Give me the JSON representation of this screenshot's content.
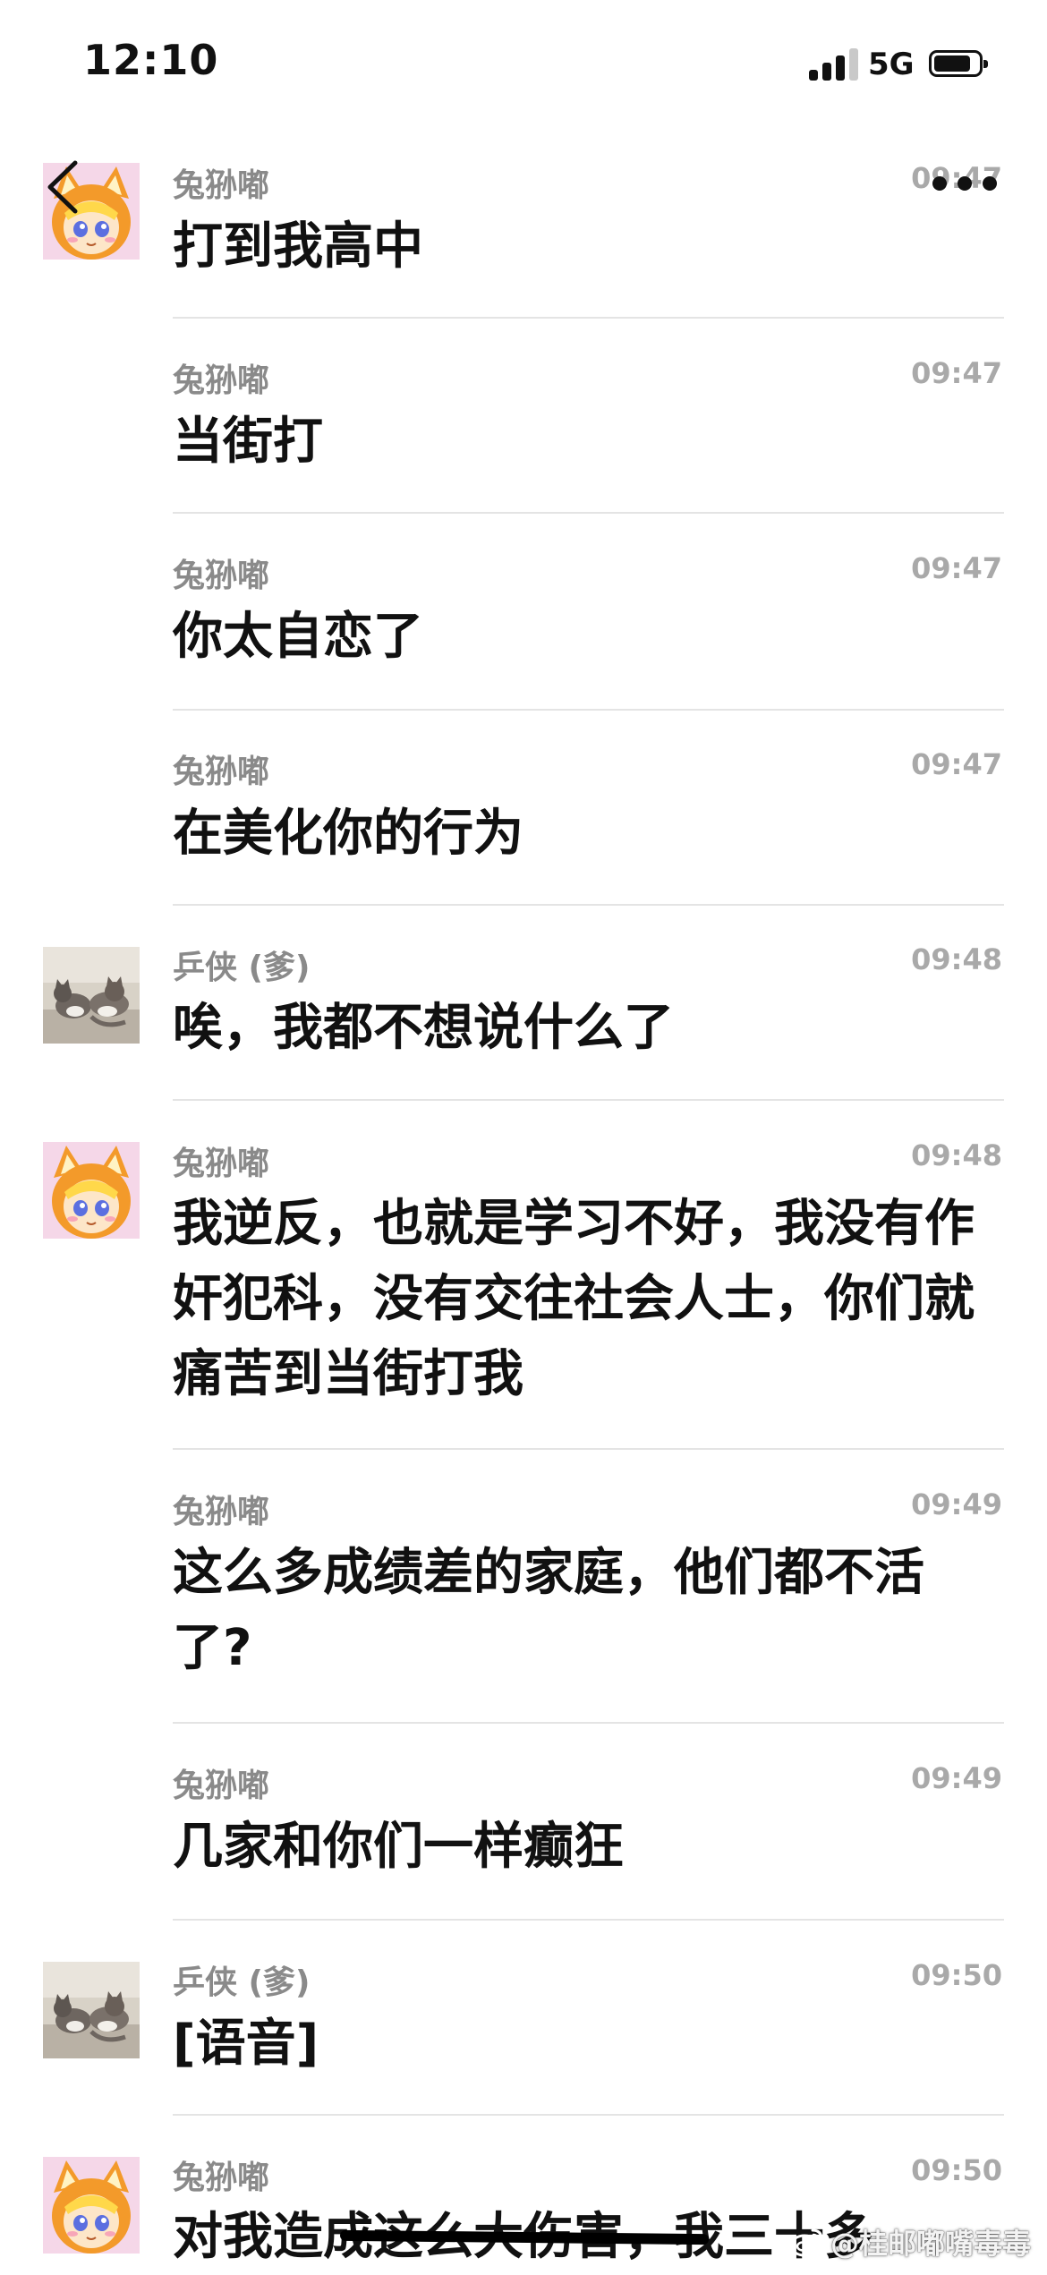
{
  "status_bar": {
    "time": "12:10",
    "network": "5G",
    "signal_bars_active": 3,
    "signal_bars_total": 4,
    "battery_level": 0.8
  },
  "nav": {
    "back_icon": "chevron-left-icon",
    "more_icon": "more-dots-icon"
  },
  "messages": [
    {
      "sender": "兔狲嘟",
      "time": "09:47",
      "text": "打到我高中",
      "avatar": "fox-avatar",
      "show_avatar": true
    },
    {
      "sender": "兔狲嘟",
      "time": "09:47",
      "text": "当街打",
      "avatar": "fox-avatar",
      "show_avatar": false
    },
    {
      "sender": "兔狲嘟",
      "time": "09:47",
      "text": "你太自恋了",
      "avatar": "fox-avatar",
      "show_avatar": false
    },
    {
      "sender": "兔狲嘟",
      "time": "09:47",
      "text": "在美化你的行为",
      "avatar": "fox-avatar",
      "show_avatar": false
    },
    {
      "sender": "乒侠 (爹)",
      "time": "09:48",
      "text": "唉，我都不想说什么了",
      "avatar": "cats-avatar",
      "show_avatar": true
    },
    {
      "sender": "兔狲嘟",
      "time": "09:48",
      "text": "我逆反，也就是学习不好，我没有作奸犯科，没有交往社会人士，你们就痛苦到当街打我",
      "avatar": "fox-avatar",
      "show_avatar": true
    },
    {
      "sender": "兔狲嘟",
      "time": "09:49",
      "text": "这么多成绩差的家庭，他们都不活了?",
      "avatar": "fox-avatar",
      "show_avatar": false
    },
    {
      "sender": "兔狲嘟",
      "time": "09:49",
      "text": "几家和你们一样癫狂",
      "avatar": "fox-avatar",
      "show_avatar": false
    },
    {
      "sender": "乒侠 (爹)",
      "time": "09:50",
      "text": "[语音]",
      "avatar": "cats-avatar",
      "show_avatar": true
    },
    {
      "sender": "兔狲嘟",
      "time": "09:50",
      "text": "对我造成这么大伤害，我三十多",
      "avatar": "fox-avatar",
      "show_avatar": true
    }
  ],
  "watermark": {
    "icon": "weibo-icon",
    "text": "@桂邮嘟嘴毒毒"
  }
}
